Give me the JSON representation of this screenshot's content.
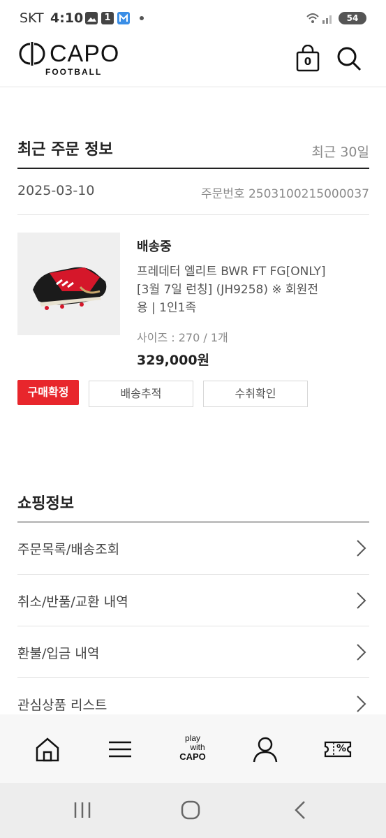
{
  "status_bar": {
    "carrier": "SKT",
    "time": "4:10",
    "notification_badge": "1",
    "battery": "54"
  },
  "header": {
    "brand": "CAPO",
    "brand_sub": "FOOTBALL",
    "cart_count": "0"
  },
  "recent_order": {
    "title": "최근 주문 정보",
    "range": "최근 30일",
    "date": "2025-03-10",
    "order_no_label": "주문번호",
    "order_no": "2503100215000037",
    "item": {
      "status": "배송중",
      "name_line1": "프레데터 엘리트 BWR FT FG[ONLY]",
      "name_line2": "[3월 7일 런칭] (JH9258) ※ 회원전",
      "name_line3": "용 | 1인1족",
      "option": "사이즈 : 270 / 1개",
      "price": "329,000원"
    },
    "buttons": {
      "confirm": "구매확정",
      "track": "배송추적",
      "receipt": "수취확인"
    }
  },
  "shopping_info": {
    "title": "쇼핑정보",
    "items": [
      {
        "label": "주문목록/배송조회"
      },
      {
        "label": "취소/반품/교환 내역"
      },
      {
        "label": "환불/입금 내역"
      },
      {
        "label": "관심상품 리스트"
      }
    ]
  },
  "bottom_nav": {
    "play_line1": "play",
    "play_line2": "with",
    "play_line3": "CAPO",
    "coupon_symbol": "%"
  },
  "colors": {
    "accent_red": "#e8262c",
    "text_dark": "#222222",
    "text_gray": "#8a8a8a"
  }
}
